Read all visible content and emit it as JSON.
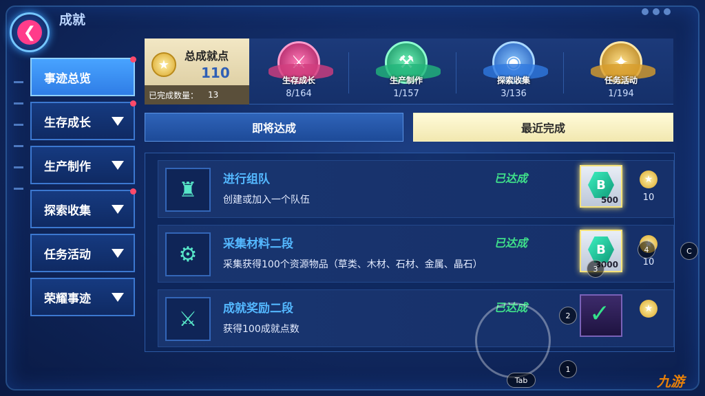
{
  "header": {
    "title": "成就"
  },
  "sidebar": {
    "items": [
      {
        "label": "事迹总览"
      },
      {
        "label": "生存成长"
      },
      {
        "label": "生产制作"
      },
      {
        "label": "探索收集"
      },
      {
        "label": "任务活动"
      },
      {
        "label": "荣耀事迹"
      }
    ]
  },
  "summary": {
    "total_label": "总成就点",
    "total_value": "110",
    "done_label": "已完成数量：",
    "done_value": "13",
    "categories": [
      {
        "name": "生存成长",
        "count": "8/164",
        "icon": "crossed-swords-icon",
        "color": "#e0468a"
      },
      {
        "name": "生产制作",
        "count": "1/157",
        "icon": "hammer-icon",
        "color": "#2bd08f"
      },
      {
        "name": "探索收集",
        "count": "3/136",
        "icon": "globe-icon",
        "color": "#3b8dff"
      },
      {
        "name": "任务活动",
        "count": "1/194",
        "icon": "scroll-icon",
        "color": "#e3a531"
      }
    ]
  },
  "tabs": {
    "upcoming": "即将达成",
    "recent": "最近完成"
  },
  "achievements": [
    {
      "title": "进行组队",
      "desc": "创建或加入一个队伍",
      "status": "已达成",
      "reward": "500",
      "points": "10",
      "icon": "castle-icon"
    },
    {
      "title": "采集材料二段",
      "desc": "采集获得100个资源物品（草类、木材、石材、金属、晶石）",
      "status": "已达成",
      "reward": "3000",
      "points": "10",
      "icon": "drill-icon"
    },
    {
      "title": "成就奖励二段",
      "desc": "获得100成就点数",
      "status": "已达成",
      "reward": "",
      "points": "",
      "icon": "crossed-swords-icon"
    }
  ],
  "hints": {
    "h4": "4",
    "h3": "3",
    "hc": "C",
    "h2": "2",
    "h1": "1",
    "tab": "Tab"
  },
  "watermark": {
    "prefix": "",
    "brand": "九游"
  }
}
